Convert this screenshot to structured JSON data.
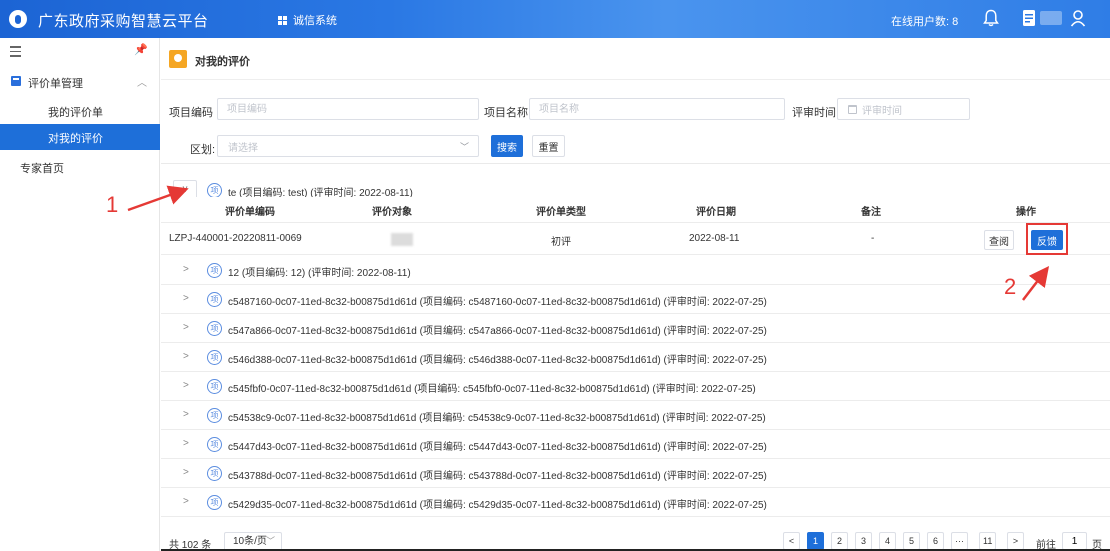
{
  "header": {
    "brand": "广东政府采购智慧云平台",
    "system": "诚信系统",
    "online_label": "在线用户数: 8"
  },
  "sidebar": {
    "group_label": "评价单管理",
    "items": [
      {
        "label": "我的评价单",
        "active": false
      },
      {
        "label": "对我的评价",
        "active": true
      }
    ],
    "expert_home": "专家首页"
  },
  "page": {
    "title": "对我的评价"
  },
  "filters": {
    "project_code_label": "项目编码",
    "project_code_placeholder": "项目编码",
    "project_name_label": "项目名称",
    "project_name_placeholder": "项目名称",
    "review_time_label": "评审时间",
    "review_time_placeholder": "评审时间",
    "region_label": "区划:",
    "region_placeholder": "请选择",
    "search_label": "搜索",
    "reset_label": "重置"
  },
  "expanded_group": {
    "badge": "项",
    "text": "te  (项目编码: test)  (评审时间: 2022-08-11)",
    "columns": [
      "评价单编码",
      "评价对象",
      "评价单类型",
      "评价日期",
      "备注",
      "操作"
    ],
    "row": {
      "code": "LZPJ-440001-20220811-0069",
      "type": "初评",
      "date": "2022-08-11",
      "remark": "-",
      "view_label": "查阅",
      "feedback_label": "反馈"
    }
  },
  "groups": [
    {
      "badge": "项",
      "text": "12  (项目编码: 12)  (评审时间: 2022-08-11)"
    },
    {
      "badge": "项",
      "text": "c5487160-0c07-11ed-8c32-b00875d1d61d  (项目编码: c5487160-0c07-11ed-8c32-b00875d1d61d)  (评审时间: 2022-07-25)"
    },
    {
      "badge": "项",
      "text": "c547a866-0c07-11ed-8c32-b00875d1d61d  (项目编码: c547a866-0c07-11ed-8c32-b00875d1d61d)  (评审时间: 2022-07-25)"
    },
    {
      "badge": "项",
      "text": "c546d388-0c07-11ed-8c32-b00875d1d61d  (项目编码: c546d388-0c07-11ed-8c32-b00875d1d61d)  (评审时间: 2022-07-25)"
    },
    {
      "badge": "项",
      "text": "c545fbf0-0c07-11ed-8c32-b00875d1d61d  (项目编码: c545fbf0-0c07-11ed-8c32-b00875d1d61d)  (评审时间: 2022-07-25)"
    },
    {
      "badge": "项",
      "text": "c54538c9-0c07-11ed-8c32-b00875d1d61d  (项目编码: c54538c9-0c07-11ed-8c32-b00875d1d61d)  (评审时间: 2022-07-25)"
    },
    {
      "badge": "项",
      "text": "c5447d43-0c07-11ed-8c32-b00875d1d61d  (项目编码: c5447d43-0c07-11ed-8c32-b00875d1d61d)  (评审时间: 2022-07-25)"
    },
    {
      "badge": "项",
      "text": "c543788d-0c07-11ed-8c32-b00875d1d61d  (项目编码: c543788d-0c07-11ed-8c32-b00875d1d61d)  (评审时间: 2022-07-25)"
    },
    {
      "badge": "项",
      "text": "c5429d35-0c07-11ed-8c32-b00875d1d61d  (项目编码: c5429d35-0c07-11ed-8c32-b00875d1d61d)  (评审时间: 2022-07-25)"
    }
  ],
  "pagination": {
    "total": "共 102 条",
    "page_size": "10条/页",
    "prev": "<",
    "pages": [
      "1",
      "2",
      "3",
      "4",
      "5",
      "6",
      "···",
      "11"
    ],
    "next": ">",
    "goto_label": "前往",
    "goto_value": "1",
    "page_unit": "页"
  },
  "annotations": {
    "step1": "1",
    "step2": "2"
  },
  "icons": {
    "logo": "shield-logo-icon",
    "system": "grid-icon",
    "bell": "bell-icon",
    "doc": "document-icon",
    "user": "user-icon"
  },
  "colors": {
    "primary": "#1e6fd9",
    "annotation": "#e53935"
  }
}
